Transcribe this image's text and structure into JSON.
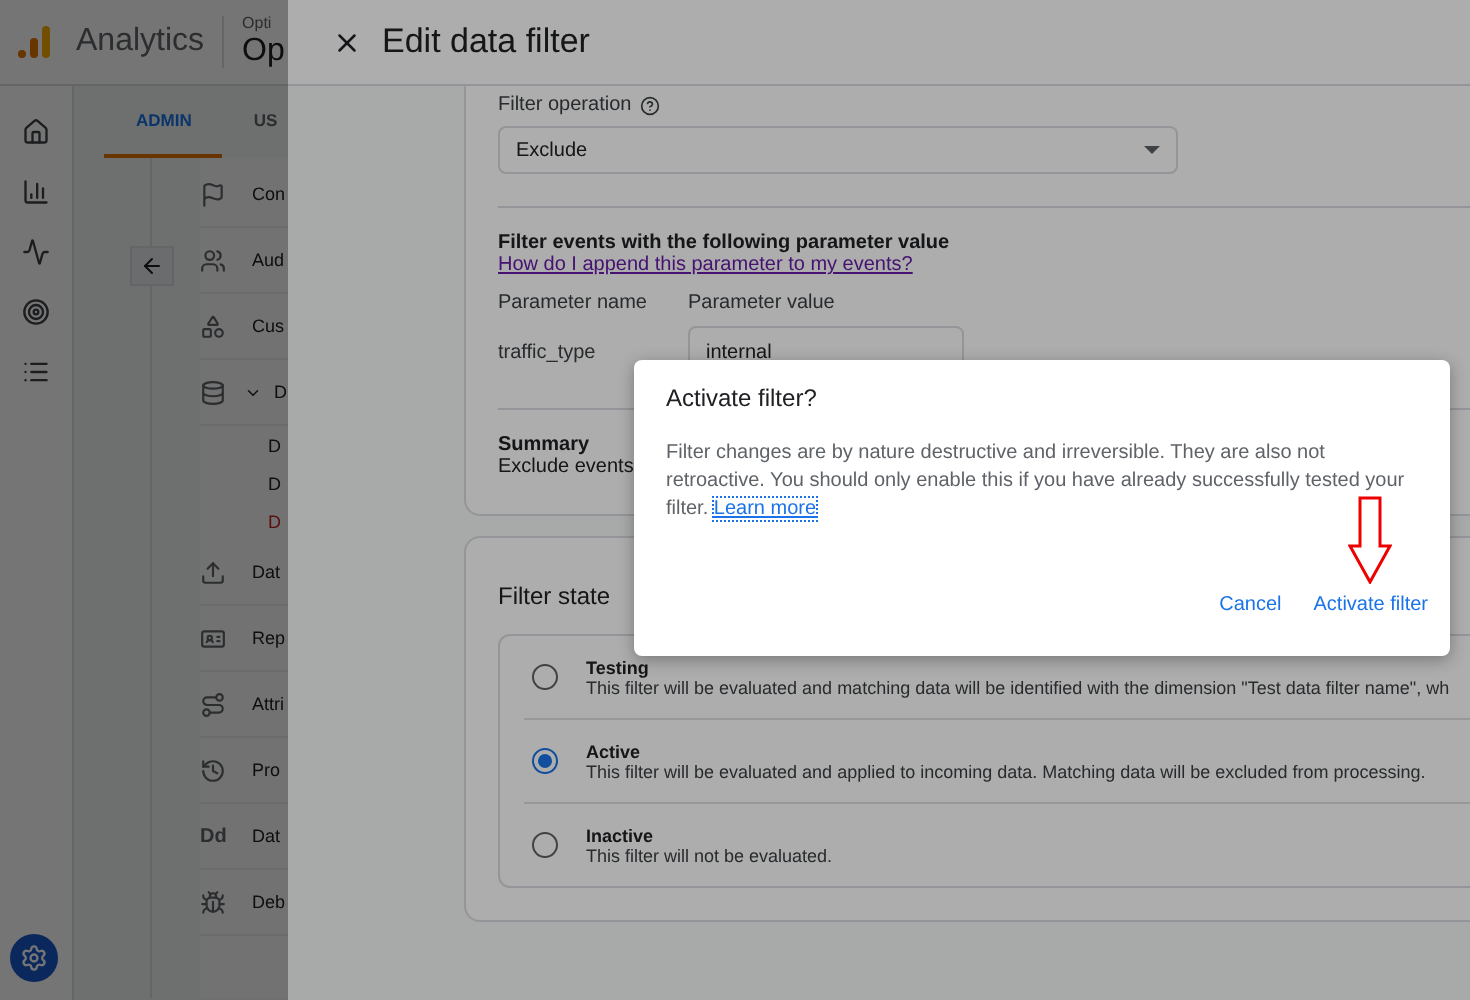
{
  "app": {
    "product": "Analytics",
    "account_label": "Opti",
    "property_name": "Op"
  },
  "tabs": [
    {
      "label": "ADMIN",
      "selected": true
    },
    {
      "label": "US",
      "selected": false
    }
  ],
  "nav": [
    {
      "label": "Con"
    },
    {
      "label": "Aud"
    },
    {
      "label": "Cus"
    },
    {
      "label": "D",
      "expanded": true,
      "children": [
        {
          "label": "D",
          "selected": false
        },
        {
          "label": "D",
          "selected": false
        },
        {
          "label": "D",
          "selected": true
        }
      ]
    },
    {
      "label": "Dat"
    },
    {
      "label": "Rep"
    },
    {
      "label": "Attri"
    },
    {
      "label": "Pro"
    },
    {
      "label": "Dat",
      "icon_text": "Dd"
    },
    {
      "label": "Deb"
    }
  ],
  "drawer": {
    "title": "Edit data filter",
    "filter_operation": {
      "label": "Filter operation",
      "value": "Exclude"
    },
    "parameter": {
      "heading": "Filter events with the following parameter value",
      "link": "How do I append this parameter to my events?",
      "name_header": "Parameter name",
      "value_header": "Parameter value",
      "name": "traffic_type",
      "value": "internal"
    },
    "summary": {
      "title": "Summary",
      "text": "Exclude events"
    },
    "filter_state": {
      "title": "Filter state",
      "options": [
        {
          "label": "Testing",
          "description": "This filter will be evaluated and matching data will be identified with the dimension \"Test data filter name\", wh",
          "selected": false
        },
        {
          "label": "Active",
          "description": "This filter will be evaluated and applied to incoming data. Matching data will be excluded from processing.",
          "selected": true
        },
        {
          "label": "Inactive",
          "description": "This filter will not be evaluated.",
          "selected": false
        }
      ]
    }
  },
  "dialog": {
    "title": "Activate filter?",
    "body": "Filter changes are by nature destructive and irreversible. They are also not retroactive. You should only enable this if you have already successfully tested your filter.",
    "link": "Learn more",
    "buttons": [
      {
        "label": "Cancel",
        "annotated": false
      },
      {
        "label": "Activate filter",
        "annotated": true
      }
    ]
  }
}
